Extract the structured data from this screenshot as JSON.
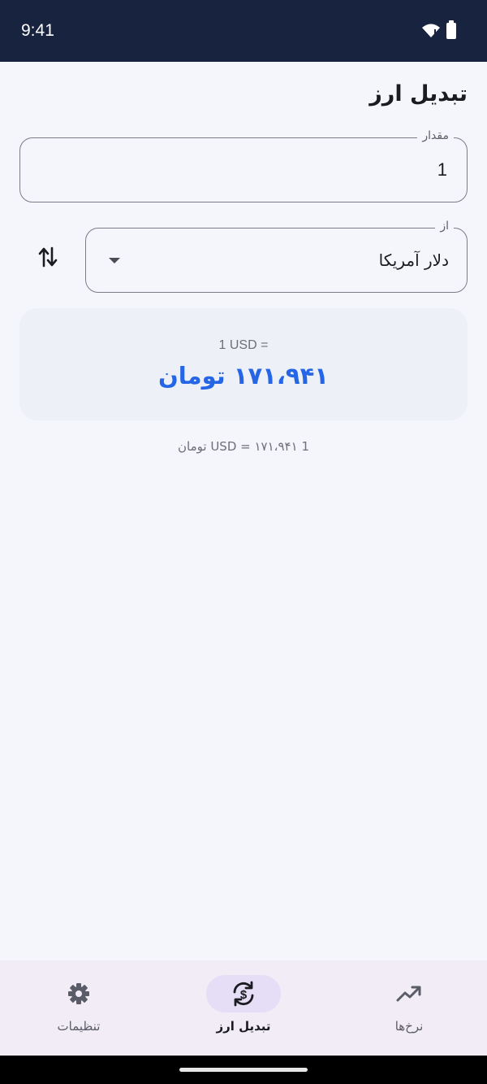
{
  "status_bar": {
    "time": "9:41",
    "icons": [
      "wifi-icon",
      "battery-icon"
    ]
  },
  "header": {
    "title": "تبدیل ارز"
  },
  "amount_field": {
    "label": "مقدار",
    "value": "1"
  },
  "from_field": {
    "label": "از",
    "value": "دلار آمریکا"
  },
  "swap_icon": "swap-vertical-icon",
  "result": {
    "equation": "1 USD =",
    "value": "۱۷۱،۹۴۱ تومان",
    "accent_color": "#2566e6"
  },
  "rate_note": "1 USD = ۱۷۱،۹۴۱ تومان",
  "bottom_nav": {
    "items": [
      {
        "label": "تنظیمات",
        "icon": "gear-icon",
        "active": false
      },
      {
        "label": "تبدیل ارز",
        "icon": "currency-exchange-icon",
        "active": true
      },
      {
        "label": "نرخ‌ها",
        "icon": "trending-up-icon",
        "active": false
      }
    ]
  },
  "colors": {
    "status_bar": "#18233f",
    "background": "#f5f6fb",
    "nav_background": "#f1ecf6",
    "active_pill": "#e5def6"
  }
}
